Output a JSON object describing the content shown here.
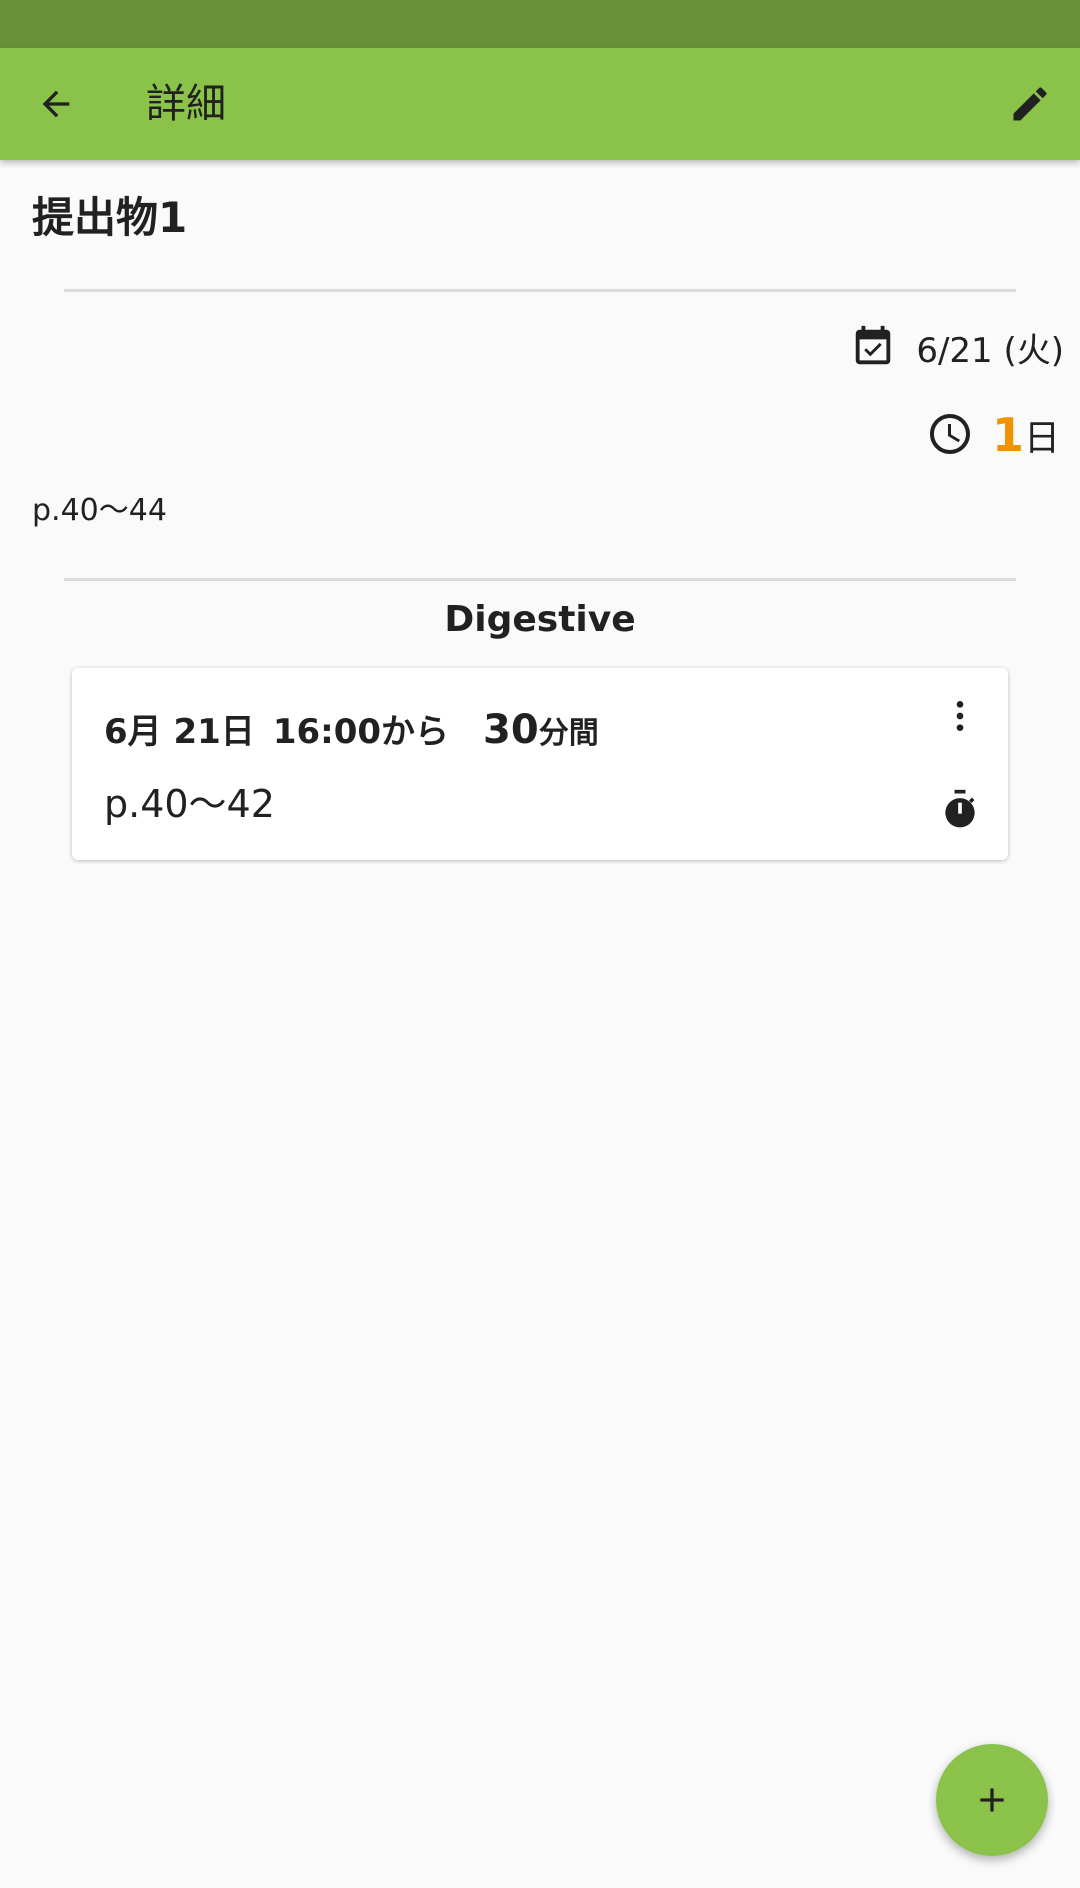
{
  "app_bar": {
    "title": "詳細",
    "back_icon": "arrow-back-icon",
    "edit_icon": "pencil-icon"
  },
  "item": {
    "title": "提出物1",
    "due_date": "6/21 (火)",
    "remaining_value": "1",
    "remaining_unit": "日",
    "note": "p.40～44"
  },
  "subject": "Digestive",
  "session": {
    "date": "6月 21日",
    "time": "16:00から",
    "duration_value": "30",
    "duration_unit": "分間",
    "pages": "p.40～42",
    "more_icon": "more-vert-icon",
    "timer_icon": "stopwatch-icon"
  },
  "fab": {
    "icon": "plus-icon"
  },
  "colors": {
    "status_bar": "#689038",
    "app_bar": "#8bc34a",
    "accent_orange": "#f39200",
    "fab": "#8bc34a"
  }
}
